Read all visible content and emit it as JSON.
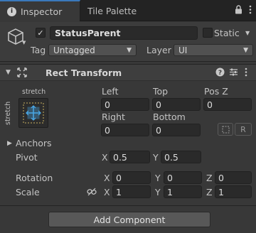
{
  "tabs": [
    {
      "label": "Inspector",
      "active": true
    },
    {
      "label": "Tile Palette",
      "active": false
    }
  ],
  "header": {
    "active_checked": true,
    "object_name": "StatusParent",
    "static_label": "Static",
    "static_checked": false,
    "tag_label": "Tag",
    "tag_value": "Untagged",
    "layer_label": "Layer",
    "layer_value": "UI"
  },
  "rect_transform": {
    "title": "Rect Transform",
    "anchor_preset_top": "stretch",
    "anchor_preset_side": "stretch",
    "fields": {
      "left_label": "Left",
      "left_value": "0",
      "top_label": "Top",
      "top_value": "0",
      "posz_label": "Pos Z",
      "posz_value": "0",
      "right_label": "Right",
      "right_value": "0",
      "bottom_label": "Bottom",
      "bottom_value": "0"
    },
    "raw_button_label": "R",
    "anchors_label": "Anchors",
    "pivot": {
      "label": "Pivot",
      "x_axis": "X",
      "x": "0.5",
      "y_axis": "Y",
      "y": "0.5"
    },
    "rotation": {
      "label": "Rotation",
      "x_axis": "X",
      "x": "0",
      "y_axis": "Y",
      "y": "0",
      "z_axis": "Z",
      "z": "0"
    },
    "scale": {
      "label": "Scale",
      "x_axis": "X",
      "x": "1",
      "y_axis": "Y",
      "y": "1",
      "z_axis": "Z",
      "z": "1"
    }
  },
  "add_component_label": "Add Component",
  "colors": {
    "accent": "#3a79bb",
    "background": "#383838",
    "anchor_blue": "#4aa8e6"
  }
}
